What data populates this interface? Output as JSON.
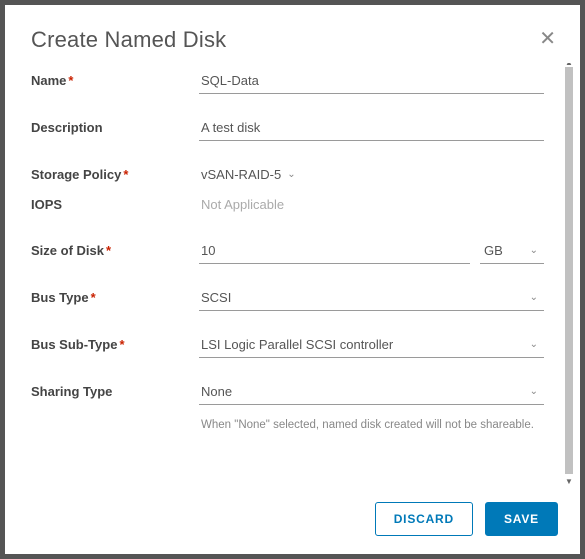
{
  "header": {
    "title": "Create Named Disk"
  },
  "fields": {
    "name": {
      "label": "Name",
      "value": "SQL-Data",
      "required": true
    },
    "description": {
      "label": "Description",
      "value": "A test disk",
      "required": false
    },
    "storagePolicy": {
      "label": "Storage Policy",
      "value": "vSAN-RAID-5",
      "required": true
    },
    "iops": {
      "label": "IOPS",
      "value": "Not Applicable",
      "required": false
    },
    "sizeOfDisk": {
      "label": "Size of Disk",
      "value": "10",
      "unit": "GB",
      "required": true
    },
    "busType": {
      "label": "Bus Type",
      "value": "SCSI",
      "required": true
    },
    "busSubType": {
      "label": "Bus Sub-Type",
      "value": "LSI Logic Parallel SCSI controller",
      "required": true
    },
    "sharingType": {
      "label": "Sharing Type",
      "value": "None",
      "hint": "When \"None\" selected, named disk created will not be shareable.",
      "required": false
    }
  },
  "footer": {
    "discard": "DISCARD",
    "save": "SAVE"
  }
}
